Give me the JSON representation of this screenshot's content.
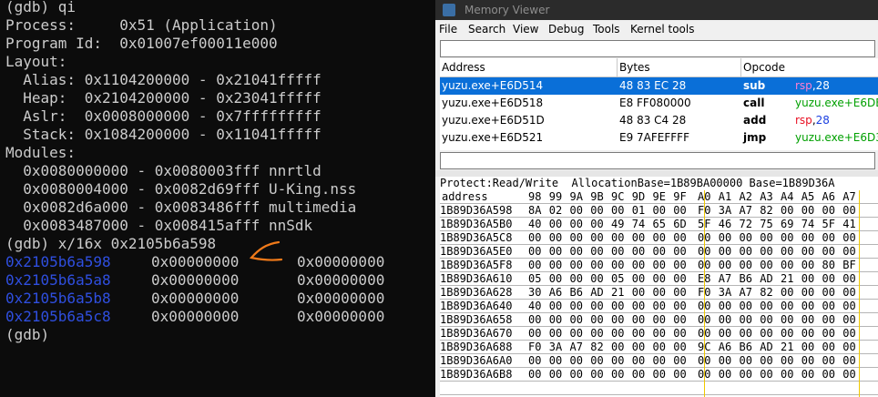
{
  "terminal": {
    "lines": [
      "(gdb) qi",
      "Process:     0x51 (Application)",
      "Program Id:  0x01007ef00011e000",
      "Layout:",
      "  Alias: 0x1104200000 - 0x21041fffff",
      "  Heap:  0x2104200000 - 0x23041fffff",
      "  Aslr:  0x0008000000 - 0x7fffffffff",
      "  Stack: 0x1084200000 - 0x11041fffff",
      "Modules:",
      "  0x0080000000 - 0x0080003fff nnrtld",
      "  0x0080004000 - 0x0082d69fff U-King.nss",
      "  0x0082d6a000 - 0x0083486fff multimedia",
      "  0x0083487000 - 0x008415afff nnSdk",
      "(gdb) x/16x 0x2105b6a598"
    ],
    "dump_rows": [
      {
        "addr": "0x2105b6a598",
        "col1": "0x00000000",
        "col2": "0x00000000"
      },
      {
        "addr": "0x2105b6a5a8",
        "col1": "0x00000000",
        "col2": "0x00000000"
      },
      {
        "addr": "0x2105b6a5b8",
        "col1": "0x00000000",
        "col2": "0x00000000"
      },
      {
        "addr": "0x2105b6a5c8",
        "col1": "0x00000000",
        "col2": "0x00000000"
      }
    ],
    "prompt": "(gdb)",
    "annotation_color": "#f07a1a",
    "address_color": "#2f4fe0"
  },
  "memory_viewer": {
    "title": "Memory Viewer",
    "menu": [
      "File",
      "Search",
      "View",
      "Debug",
      "Tools",
      "Kernel tools"
    ],
    "disassembly": {
      "headers": [
        "Address",
        "Bytes",
        "Opcode"
      ],
      "rows": [
        {
          "address": "yuzu.exe+E6D514",
          "bytes": "48 83 EC 28",
          "opcode": "sub",
          "a1": "rsp",
          "sep": ",",
          "a2": "28",
          "a2_kind": "num",
          "selected": true
        },
        {
          "address": "yuzu.exe+E6D518",
          "bytes": "E8 FF080000",
          "opcode": "call",
          "a1": "",
          "sep": "",
          "a2": "yuzu.exe+E6DE",
          "a2_kind": "lbl",
          "selected": false
        },
        {
          "address": "yuzu.exe+E6D51D",
          "bytes": "48 83 C4 28",
          "opcode": "add",
          "a1": "rsp",
          "sep": ",",
          "a2": "28",
          "a2_kind": "num",
          "selected": false
        },
        {
          "address": "yuzu.exe+E6D521",
          "bytes": "E9 7AFEFFFF",
          "opcode": "jmp",
          "a1": "",
          "sep": "",
          "a2": "yuzu.exe+E6D3",
          "a2_kind": "lbl",
          "selected": false
        }
      ]
    },
    "hex": {
      "protect_line": "Protect:Read/Write  AllocationBase=1B89BA00000 Base=1B89D36A",
      "header_label": "address",
      "columns": [
        "98",
        "99",
        "9A",
        "9B",
        "9C",
        "9D",
        "9E",
        "9F",
        "A0",
        "A1",
        "A2",
        "A3",
        "A4",
        "A5",
        "A6",
        "A7"
      ],
      "rows": [
        {
          "addr": "1B89D36A598",
          "bytes": [
            "8A",
            "02",
            "00",
            "00",
            "00",
            "01",
            "00",
            "00",
            "F0",
            "3A",
            "A7",
            "82",
            "00",
            "00",
            "00",
            "00"
          ]
        },
        {
          "addr": "1B89D36A5B0",
          "bytes": [
            "40",
            "00",
            "00",
            "00",
            "49",
            "74",
            "65",
            "6D",
            "5F",
            "46",
            "72",
            "75",
            "69",
            "74",
            "5F",
            "41"
          ]
        },
        {
          "addr": "1B89D36A5C8",
          "bytes": [
            "00",
            "00",
            "00",
            "00",
            "00",
            "00",
            "00",
            "00",
            "00",
            "00",
            "00",
            "00",
            "00",
            "00",
            "00",
            "00"
          ]
        },
        {
          "addr": "1B89D36A5E0",
          "bytes": [
            "00",
            "00",
            "00",
            "00",
            "00",
            "00",
            "00",
            "00",
            "00",
            "00",
            "00",
            "00",
            "00",
            "00",
            "00",
            "00"
          ]
        },
        {
          "addr": "1B89D36A5F8",
          "bytes": [
            "00",
            "00",
            "00",
            "00",
            "00",
            "00",
            "00",
            "00",
            "00",
            "00",
            "00",
            "00",
            "00",
            "00",
            "80",
            "BF"
          ]
        },
        {
          "addr": "1B89D36A610",
          "bytes": [
            "05",
            "00",
            "00",
            "00",
            "05",
            "00",
            "00",
            "00",
            "E8",
            "A7",
            "B6",
            "AD",
            "21",
            "00",
            "00",
            "00"
          ]
        },
        {
          "addr": "1B89D36A628",
          "bytes": [
            "30",
            "A6",
            "B6",
            "AD",
            "21",
            "00",
            "00",
            "00",
            "F0",
            "3A",
            "A7",
            "82",
            "00",
            "00",
            "00",
            "00"
          ]
        },
        {
          "addr": "1B89D36A640",
          "bytes": [
            "40",
            "00",
            "00",
            "00",
            "00",
            "00",
            "00",
            "00",
            "00",
            "00",
            "00",
            "00",
            "00",
            "00",
            "00",
            "00"
          ]
        },
        {
          "addr": "1B89D36A658",
          "bytes": [
            "00",
            "00",
            "00",
            "00",
            "00",
            "00",
            "00",
            "00",
            "00",
            "00",
            "00",
            "00",
            "00",
            "00",
            "00",
            "00"
          ]
        },
        {
          "addr": "1B89D36A670",
          "bytes": [
            "00",
            "00",
            "00",
            "00",
            "00",
            "00",
            "00",
            "00",
            "00",
            "00",
            "00",
            "00",
            "00",
            "00",
            "00",
            "00"
          ]
        },
        {
          "addr": "1B89D36A688",
          "bytes": [
            "F0",
            "3A",
            "A7",
            "82",
            "00",
            "00",
            "00",
            "00",
            "9C",
            "A6",
            "B6",
            "AD",
            "21",
            "00",
            "00",
            "00"
          ]
        },
        {
          "addr": "1B89D36A6A0",
          "bytes": [
            "00",
            "00",
            "00",
            "00",
            "00",
            "00",
            "00",
            "00",
            "00",
            "00",
            "00",
            "00",
            "00",
            "00",
            "00",
            "00"
          ]
        },
        {
          "addr": "1B89D36A6B8",
          "bytes": [
            "00",
            "00",
            "00",
            "00",
            "00",
            "00",
            "00",
            "00",
            "00",
            "00",
            "00",
            "00",
            "00",
            "00",
            "00",
            "00"
          ]
        }
      ]
    },
    "colors": {
      "selection": "#0a6fd8",
      "register": "#e81123",
      "number": "#1a3fe0",
      "label": "#00a000",
      "column_divider": "#f0c800"
    }
  }
}
